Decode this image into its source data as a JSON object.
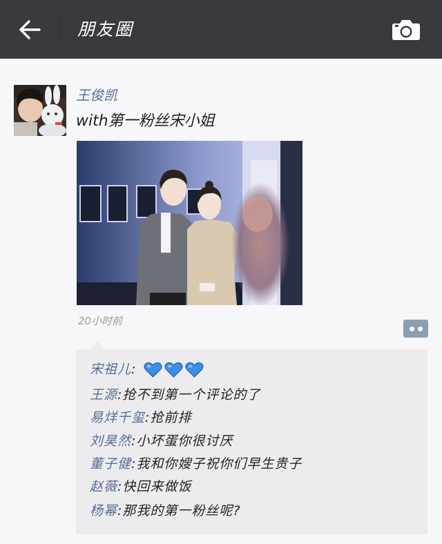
{
  "header": {
    "title": "朋友圈",
    "back_icon": "arrow-left-icon",
    "camera_icon": "camera-icon"
  },
  "post": {
    "author": "王俊凯",
    "text": "with第一粉丝宋小姐",
    "time": "20小时前"
  },
  "comments": [
    {
      "name": "宋祖儿",
      "sep": ":",
      "text": "",
      "hearts": 3
    },
    {
      "name": "王源",
      "sep": ":",
      "text": "抢不到第一个评论的了"
    },
    {
      "name": "易烊千玺",
      "sep": ":",
      "text": "抢前排"
    },
    {
      "name": "刘昊然",
      "sep": ":",
      "text": "小坏蛋你很讨厌"
    },
    {
      "name": "董子健",
      "sep": ":",
      "text": "我和你嫂子祝你们早生贵子"
    },
    {
      "name": "赵薇",
      "sep": ":",
      "text": "快回来做饭"
    },
    {
      "name": "杨幂",
      "sep": ":",
      "text": "那我的第一粉丝呢?"
    }
  ],
  "colors": {
    "topbar": "#393a3f",
    "link": "#576b95",
    "heart": "#3a8ee6"
  }
}
